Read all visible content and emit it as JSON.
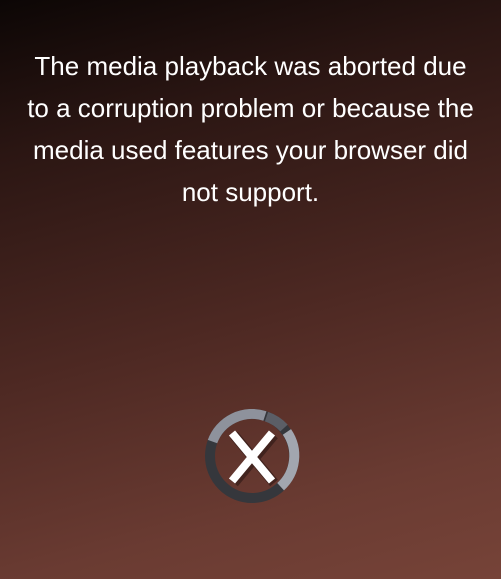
{
  "player": {
    "error_message": "The media playback was aborted due to a corruption problem or because the media used features your browser did not support.",
    "error_icon": "error-x-icon"
  },
  "colors": {
    "background_top": "#0c0605",
    "background_bottom": "#764338",
    "text": "#ffffff",
    "ring_light": "#8e929c",
    "ring_dark": "#3a3c41"
  }
}
